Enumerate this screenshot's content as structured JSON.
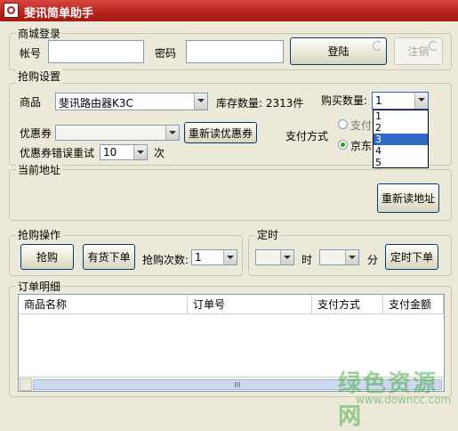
{
  "window": {
    "title": "斐讯简单助手"
  },
  "login": {
    "group_label": "商城登录",
    "account_label": "帐号",
    "password_label": "密码",
    "login_button": "登陆",
    "logout_button": "注销"
  },
  "purchase_settings": {
    "group_label": "抢购设置",
    "product_label": "商品",
    "product_value": "斐讯路由器K3C",
    "stock_text": "库存数量: 2313件",
    "quantity_label": "购买数量:",
    "quantity_value": "1",
    "quantity_options": [
      "1",
      "2",
      "3",
      "4",
      "5"
    ],
    "quantity_highlighted": "3",
    "coupon_label": "优惠券",
    "reload_coupon_button": "重新读优惠券",
    "payment_label": "支付方式",
    "payment_option_1": "支付",
    "payment_option_2": "京东",
    "retry_label": "优惠券错误重试",
    "retry_value": "10",
    "retry_unit": "次"
  },
  "address": {
    "group_label": "当前地址",
    "reload_button": "重新读地址"
  },
  "operation": {
    "group_label": "抢购操作",
    "buy_button": "抢购",
    "instock_button": "有货下单",
    "count_label": "抢购次数:",
    "count_value": "1"
  },
  "timer": {
    "group_label": "定时",
    "hour_label": "时",
    "minute_label": "分",
    "timed_order_button": "定时下单"
  },
  "orders": {
    "group_label": "订单明细",
    "columns": [
      "商品名称",
      "订单号",
      "支付方式",
      "支付金额"
    ],
    "scroll_thumb": "III"
  },
  "watermark": {
    "main": "绿色资源网",
    "url": "www.downcc.com"
  }
}
